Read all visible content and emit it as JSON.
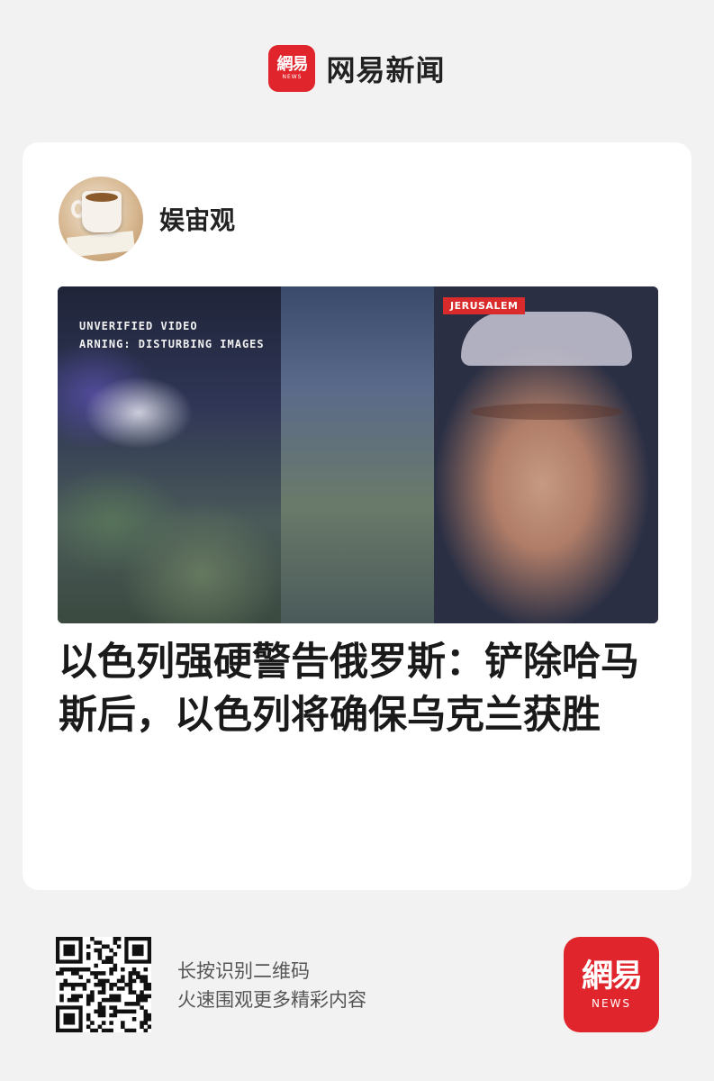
{
  "header": {
    "logo_cn": "網易",
    "logo_en": "NEWS",
    "brand_name": "网易新闻"
  },
  "card": {
    "author": {
      "name": "娱宙观",
      "avatar_icon": "coffee-cup-avatar"
    },
    "video": {
      "warning_text": "UNVERIFIED VIDEO\nARNING: DISTURBING IMAGES",
      "location_tag": "JERUSALEM"
    },
    "headline": "以色列强硬警告俄罗斯：铲除哈马斯后，以色列将确保乌克兰获胜"
  },
  "footer": {
    "scan_line1": "长按识别二维码",
    "scan_line2": "火速围观更多精彩内容",
    "qr_icon": "qr-code-icon",
    "logo_cn": "網易",
    "logo_en": "NEWS",
    "brand_color": "#e0252c"
  }
}
